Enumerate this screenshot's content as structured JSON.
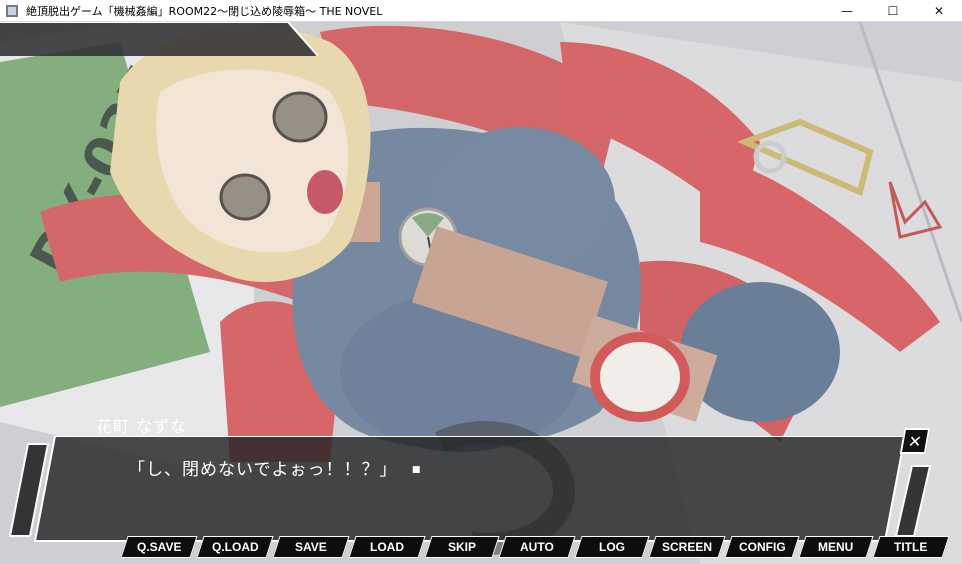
{
  "window": {
    "title": "絶頂脱出ゲーム「機械姦編」ROOM22～閉じ込め陵辱箱～ THE NOVEL",
    "minimize": "—",
    "maximize": "☐",
    "close": "✕"
  },
  "scene": {
    "sign_text": "DX-037"
  },
  "dialog": {
    "speaker": "花町 なずな",
    "line": "「し、閉めないでよぉっ！！？」",
    "cursor": "■",
    "close_icon": "✕"
  },
  "menu": {
    "items": [
      "Q.SAVE",
      "Q.LOAD",
      "SAVE",
      "LOAD",
      "SKIP",
      "AUTO",
      "LOG",
      "SCREEN",
      "CONFIG",
      "MENU",
      "TITLE"
    ]
  }
}
